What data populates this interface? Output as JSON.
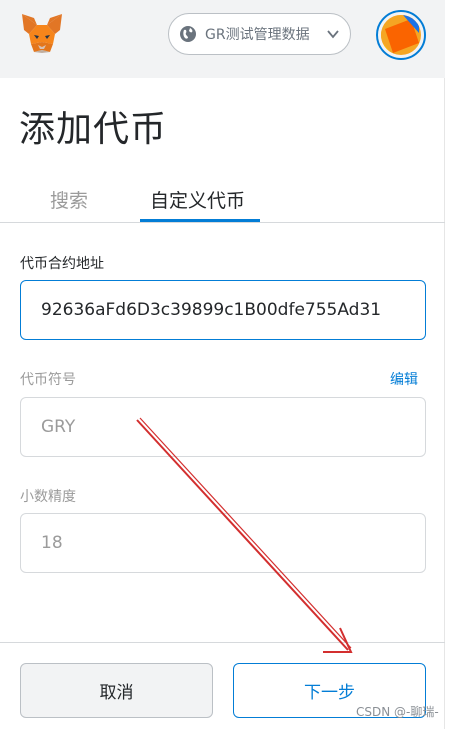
{
  "header": {
    "network_label": "GR测试管理数据"
  },
  "page": {
    "title": "添加代币"
  },
  "tabs": {
    "search": "搜索",
    "custom": "自定义代币"
  },
  "form": {
    "contract_label": "代币合约地址",
    "contract_value": "92636aFd6D3c39899c1B00dfe755Ad31",
    "symbol_label": "代币符号",
    "symbol_edit": "编辑",
    "symbol_value": "GRY",
    "decimals_label": "小数精度",
    "decimals_value": "18"
  },
  "footer": {
    "cancel_label": "取消",
    "next_label": "下一步"
  },
  "watermark": "CSDN @-聊瑞-",
  "colors": {
    "accent": "#037dd6",
    "annotation_arrow": "#d32f2f"
  },
  "icons": [
    "metamask-fox-icon",
    "globe-icon",
    "chevron-down-icon",
    "account-avatar"
  ]
}
